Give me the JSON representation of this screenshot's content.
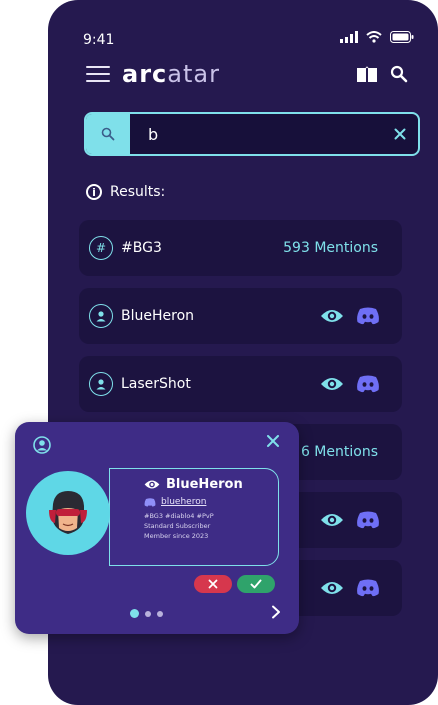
{
  "status_bar": {
    "time": "9:41"
  },
  "app": {
    "logo_part1": "arc",
    "logo_part2": "atar"
  },
  "search": {
    "value": "b",
    "icon": "search-icon"
  },
  "results_label": "Results:",
  "results": [
    {
      "type": "tag",
      "label": "#BG3",
      "mentions": "593 Mentions"
    },
    {
      "type": "user",
      "label": "BlueHeron"
    },
    {
      "type": "user",
      "label": "LaserShot"
    },
    {
      "type": "tag",
      "label": "#...",
      "mentions": "6 Mentions"
    }
  ],
  "profile_card": {
    "name": "BlueHeron",
    "discord": "blueheron",
    "tags": "#BG3   #diablo4   #PvP",
    "subscription": "Standard Subscriber",
    "member_since": "Member since 2023"
  },
  "colors": {
    "background": "#25194f",
    "card": "#3e2c86",
    "accent": "#7fe0ea",
    "reject": "#d6374d",
    "accept": "#2fa36b",
    "discord": "#6f6ff5"
  }
}
